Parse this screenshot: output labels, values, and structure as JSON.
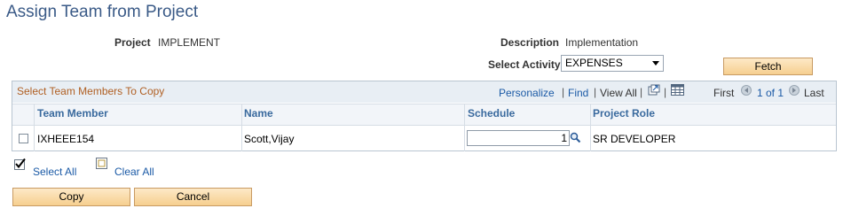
{
  "page": {
    "title": "Assign Team from Project"
  },
  "project": {
    "label": "Project",
    "value": "IMPLEMENT"
  },
  "description": {
    "label": "Description",
    "value": "Implementation"
  },
  "select_activity": {
    "label": "Select Activity",
    "value": "EXPENSES"
  },
  "buttons": {
    "fetch": "Fetch",
    "copy": "Copy",
    "cancel": "Cancel"
  },
  "grid": {
    "title": "Select Team Members To Copy",
    "toolbar": {
      "personalize": "Personalize",
      "find": "Find",
      "view_all": "View All",
      "sep": "|"
    },
    "pager": {
      "first": "First",
      "range": "1 of 1",
      "last": "Last"
    },
    "columns": [
      "Team Member",
      "Name",
      "Schedule",
      "Project Role"
    ],
    "rows": [
      {
        "checked": false,
        "team_member": "IXHEEE154",
        "name": "Scott,Vijay",
        "schedule": "1",
        "project_role": "SR DEVELOPER"
      }
    ]
  },
  "selection": {
    "select_all": "Select All",
    "clear_all": "Clear All"
  },
  "icons": {
    "zoom": "zoom-icon",
    "spreadsheet": "spreadsheet-icon",
    "prev": "prev-arrow-icon",
    "next": "next-arrow-icon",
    "lookup": "magnifier-icon",
    "checkbox_checked": "checkmark-icon",
    "checkbox_empty": "empty-checkbox-icon"
  },
  "colors": {
    "title": "#3a5a87",
    "link": "#1b5aa6",
    "grid_title": "#b06024",
    "button_bg": "#f6cf8f"
  }
}
